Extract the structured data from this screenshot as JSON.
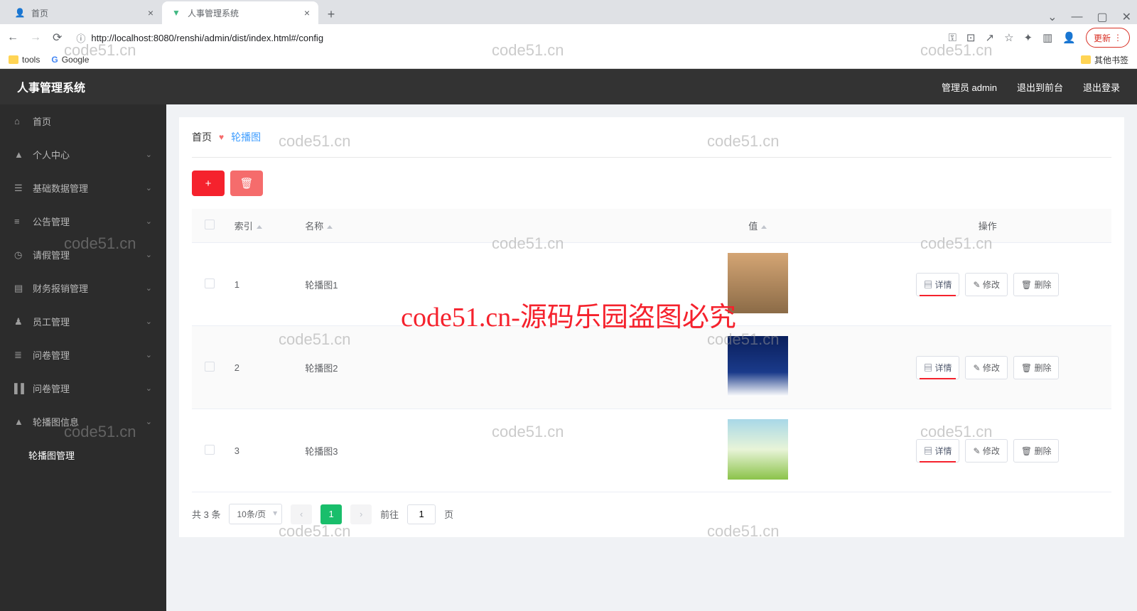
{
  "browser": {
    "tabs": [
      {
        "title": "首页",
        "active": false
      },
      {
        "title": "人事管理系统",
        "active": true
      }
    ],
    "url": "http://localhost:8080/renshi/admin/dist/index.html#/config",
    "update_label": "更新",
    "bookmarks": {
      "tools": "tools",
      "google": "Google",
      "other": "其他书签"
    }
  },
  "header": {
    "title": "人事管理系统",
    "admin_label": "管理员 admin",
    "exit_front": "退出到前台",
    "logout": "退出登录"
  },
  "sidebar": {
    "items": [
      {
        "label": "首页",
        "icon": "home"
      },
      {
        "label": "个人中心",
        "icon": "user",
        "expandable": true
      },
      {
        "label": "基础数据管理",
        "icon": "data",
        "expandable": true
      },
      {
        "label": "公告管理",
        "icon": "announce",
        "expandable": true
      },
      {
        "label": "请假管理",
        "icon": "leave",
        "expandable": true
      },
      {
        "label": "财务报销管理",
        "icon": "finance",
        "expandable": true
      },
      {
        "label": "员工管理",
        "icon": "employee",
        "expandable": true
      },
      {
        "label": "问卷管理",
        "icon": "survey1",
        "expandable": true
      },
      {
        "label": "问卷管理",
        "icon": "survey2",
        "expandable": true
      },
      {
        "label": "轮播图信息",
        "icon": "carousel",
        "expandable": true
      }
    ],
    "sub_item": "轮播图管理"
  },
  "breadcrumb": {
    "home": "首页",
    "current": "轮播图"
  },
  "table": {
    "headers": {
      "index": "索引",
      "name": "名称",
      "value": "值",
      "ops": "操作"
    },
    "rows": [
      {
        "idx": "1",
        "name": "轮播图1"
      },
      {
        "idx": "2",
        "name": "轮播图2"
      },
      {
        "idx": "3",
        "name": "轮播图3"
      }
    ],
    "ops": {
      "detail": "详情",
      "edit": "修改",
      "delete": "删除"
    }
  },
  "pagination": {
    "total": "共 3 条",
    "page_size": "10条/页",
    "current": "1",
    "goto_prefix": "前往",
    "goto_suffix": "页",
    "goto_value": "1"
  },
  "watermarks": {
    "text": "code51.cn",
    "big": "code51.cn-源码乐园盗图必究"
  }
}
